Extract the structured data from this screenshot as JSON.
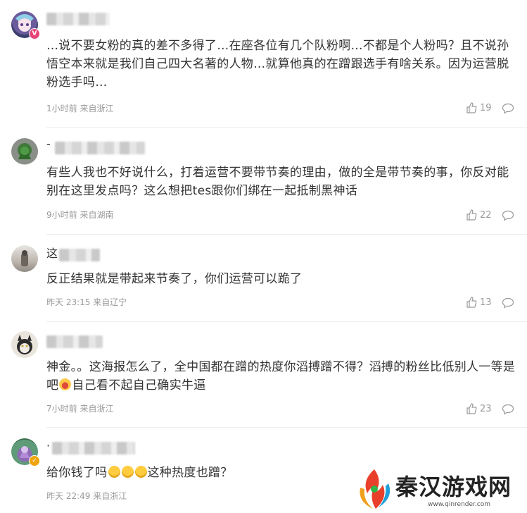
{
  "comments": [
    {
      "name_first": "",
      "text": "…说不要女粉的真的差不多得了…在座各位有几个队粉啊…不都是个人粉吗？且不说孙悟空本来就是我们自己四大名著的人物…就算他真的在蹭跟选手有啥关系。因为运营脱粉选手吗…",
      "meta": "1小时前 来自浙江",
      "likes": "19",
      "badge": "V"
    },
    {
      "name_first": "-",
      "text": "有些人我也不好说什么，打着运营不要带节奏的理由，做的全是带节奏的事，你反对能别在这里发点吗？这么想把tes跟你们绑在一起抵制黑神话",
      "meta": "9小时前 来自湖南",
      "likes": "22"
    },
    {
      "name_first": "这",
      "text": "反正结果就是带起来节奏了，你们运营可以跪了",
      "meta": "昨天 23:15 来自辽宁",
      "likes": "13"
    },
    {
      "name_first": "",
      "text_a": "神金。。这海报怎么了，全中国都在蹭的热度你滔搏蹭不得？滔搏的粉丝比低别人一等是吧",
      "text_b": "自己看不起自己确实牛逼",
      "meta": "7小时前 来自浙江",
      "likes": "23"
    },
    {
      "name_first": "·",
      "text_a": "给你钱了吗",
      "text_b": "这种热度也蹭？",
      "meta": "昨天 22:49 来自浙江",
      "badge": "✓"
    }
  ],
  "watermark": {
    "title": "秦汉游戏网",
    "url": "www.qinrender.com"
  },
  "colors": {
    "vip_badge": "#e6457a",
    "verified_badge": "#f0a30a",
    "meta": "#999999"
  }
}
